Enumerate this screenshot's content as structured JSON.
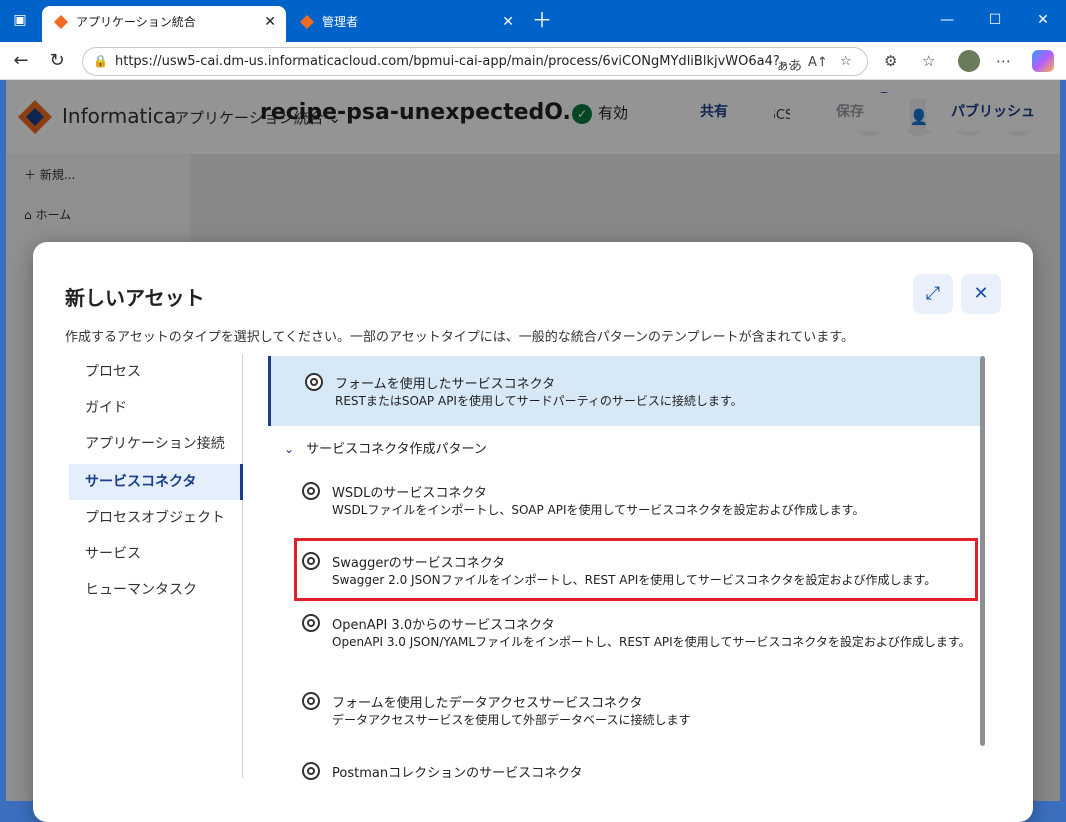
{
  "browser": {
    "tabs": [
      {
        "title": "アプリケーション統合",
        "active": true
      },
      {
        "title": "管理者",
        "active": false
      }
    ],
    "url": "https://usw5-cai.dm-us.informaticacloud.com/bpmui-cai-app/main/process/6viCONgMYdliBlkjvWO6a4?..."
  },
  "app": {
    "brand": "Informatica",
    "app_name": "アプリケーション統合",
    "org": "JP GCS",
    "notification_count": "1",
    "sidebar": [
      "新規...",
      "ホーム"
    ],
    "process_name": "recipe-psa-unexpectedO...",
    "valid_label": "有効",
    "buttons": {
      "share": "共有",
      "save": "保存",
      "publish": "パブリッシュ"
    }
  },
  "modal": {
    "title": "新しいアセット",
    "description": "作成するアセットのタイプを選択してください。一部のアセットタイプには、一般的な統合パターンのテンプレートが含まれています。",
    "asset_types": [
      {
        "label": "プロセス",
        "selected": false
      },
      {
        "label": "ガイド",
        "selected": false
      },
      {
        "label": "アプリケーション接続",
        "selected": false
      },
      {
        "label": "サービスコネクタ",
        "selected": true
      },
      {
        "label": "プロセスオブジェクト",
        "selected": false
      },
      {
        "label": "サービス",
        "selected": false
      },
      {
        "label": "ヒューマンタスク",
        "selected": false
      }
    ],
    "group_header": "サービスコネクタ作成パターン",
    "assets": [
      {
        "title": "フォームを使用したサービスコネクタ",
        "desc": "RESTまたはSOAP APIを使用してサードパーティのサービスに接続します。"
      },
      {
        "title": "WSDLのサービスコネクタ",
        "desc": "WSDLファイルをインポートし、SOAP APIを使用してサービスコネクタを設定および作成します。"
      },
      {
        "title": "Swaggerのサービスコネクタ",
        "desc": "Swagger 2.0 JSONファイルをインポートし、REST APIを使用してサービスコネクタを設定および作成します。"
      },
      {
        "title": "OpenAPI 3.0からのサービスコネクタ",
        "desc": "OpenAPI 3.0 JSON/YAMLファイルをインポートし、REST APIを使用してサービスコネクタを設定および作成します。"
      },
      {
        "title": "フォームを使用したデータアクセスサービスコネクタ",
        "desc": "データアクセスサービスを使用して外部データベースに接続します"
      },
      {
        "title": "Postmanコレクションのサービスコネクタ",
        "desc": ""
      }
    ]
  },
  "icons": {
    "expand": "expand-icon",
    "close": "close-icon"
  }
}
